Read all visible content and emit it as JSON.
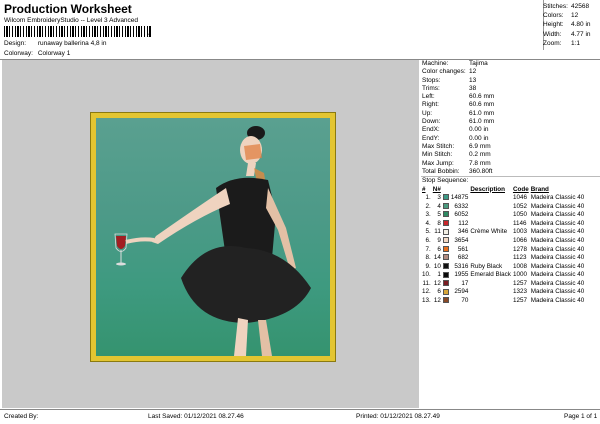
{
  "header": {
    "title": "Production Worksheet",
    "subtitle": "Wilcom EmbroideryStudio -- Level 3 Advanced",
    "barcode_suffix": ",",
    "design_label": "Design:",
    "design_value": "runaway ballerina 4,8 in",
    "colorway_label": "Colorway:",
    "colorway_value": "Colorway 1"
  },
  "summary": [
    {
      "k": "Stitches:",
      "v": "42568"
    },
    {
      "k": "Colors:",
      "v": "12"
    },
    {
      "k": "Height:",
      "v": "4.80 in"
    },
    {
      "k": "Width:",
      "v": "4.77 in"
    },
    {
      "k": "Zoom:",
      "v": "1:1"
    }
  ],
  "machine_info": [
    {
      "k": "Machine:",
      "v": "Tajima"
    },
    {
      "k": "Color changes:",
      "v": "12"
    },
    {
      "k": "Stops:",
      "v": "13"
    },
    {
      "k": "Trims:",
      "v": "38"
    },
    {
      "k": "Left:",
      "v": "60.6 mm"
    },
    {
      "k": "Right:",
      "v": "60.6 mm"
    },
    {
      "k": "Up:",
      "v": "61.0 mm"
    },
    {
      "k": "Down:",
      "v": "61.0 mm"
    },
    {
      "k": "EndX:",
      "v": "0.00 in"
    },
    {
      "k": "EndY:",
      "v": "0.00 in"
    },
    {
      "k": "Max Stitch:",
      "v": "6.9 mm"
    },
    {
      "k": "Min Stitch:",
      "v": "0.2 mm"
    },
    {
      "k": "Max Jump:",
      "v": "7.8 mm"
    },
    {
      "k": "Total Bobbin:",
      "v": "360.80ft"
    }
  ],
  "stop_sequence": {
    "label": "Stop Sequence:",
    "headers": {
      "num": "#",
      "n": "N#",
      "desc": "Description",
      "code": "Code",
      "brand": "Brand"
    },
    "rows": [
      {
        "num": "1.",
        "n": "3",
        "color": "#3d9a86",
        "stitches": "14875",
        "desc": "",
        "code": "1046",
        "brand": "Madeira Classic 40"
      },
      {
        "num": "2.",
        "n": "4",
        "color": "#4a9a7e",
        "stitches": "6332",
        "desc": "",
        "code": "1052",
        "brand": "Madeira Classic 40"
      },
      {
        "num": "3.",
        "n": "5",
        "color": "#2e8a62",
        "stitches": "6052",
        "desc": "",
        "code": "1050",
        "brand": "Madeira Classic 40"
      },
      {
        "num": "4.",
        "n": "8",
        "color": "#c8262a",
        "stitches": "112",
        "desc": "",
        "code": "1146",
        "brand": "Madeira Classic 40"
      },
      {
        "num": "5.",
        "n": "11",
        "color": "#f2efe4",
        "stitches": "346",
        "desc": "Crème White",
        "code": "1003",
        "brand": "Madeira Classic 40"
      },
      {
        "num": "6.",
        "n": "9",
        "color": "#f3d9c4",
        "stitches": "3654",
        "desc": "",
        "code": "1066",
        "brand": "Madeira Classic 40"
      },
      {
        "num": "7.",
        "n": "6",
        "color": "#e86f1c",
        "stitches": "561",
        "desc": "",
        "code": "1278",
        "brand": "Madeira Classic 40"
      },
      {
        "num": "8.",
        "n": "14",
        "color": "#b28c80",
        "stitches": "682",
        "desc": "",
        "code": "1123",
        "brand": "Madeira Classic 40"
      },
      {
        "num": "9.",
        "n": "10",
        "color": "#111111",
        "stitches": "5316",
        "desc": "Ruby Black",
        "code": "1008",
        "brand": "Madeira Classic 40"
      },
      {
        "num": "10.",
        "n": "1",
        "color": "#0a0a0a",
        "stitches": "1955",
        "desc": "Emerald Black",
        "code": "1000",
        "brand": "Madeira Classic 40"
      },
      {
        "num": "11.",
        "n": "12",
        "color": "#7a1c22",
        "stitches": "17",
        "desc": "",
        "code": "1257",
        "brand": "Madeira Classic 40"
      },
      {
        "num": "12.",
        "n": "6",
        "color": "#d9a83a",
        "stitches": "2594",
        "desc": "",
        "code": "1323",
        "brand": "Madeira Classic 40"
      },
      {
        "num": "13.",
        "n": "12",
        "color": "#8a4a26",
        "stitches": "70",
        "desc": "",
        "code": "1257",
        "brand": "Madeira Classic 40"
      }
    ]
  },
  "footer": {
    "created_by": "Created By:",
    "last_saved": "Last Saved: 01/12/2021 08.27.46",
    "printed": "Printed: 01/12/2021 08.27.49",
    "page": "Page 1 of 1"
  }
}
